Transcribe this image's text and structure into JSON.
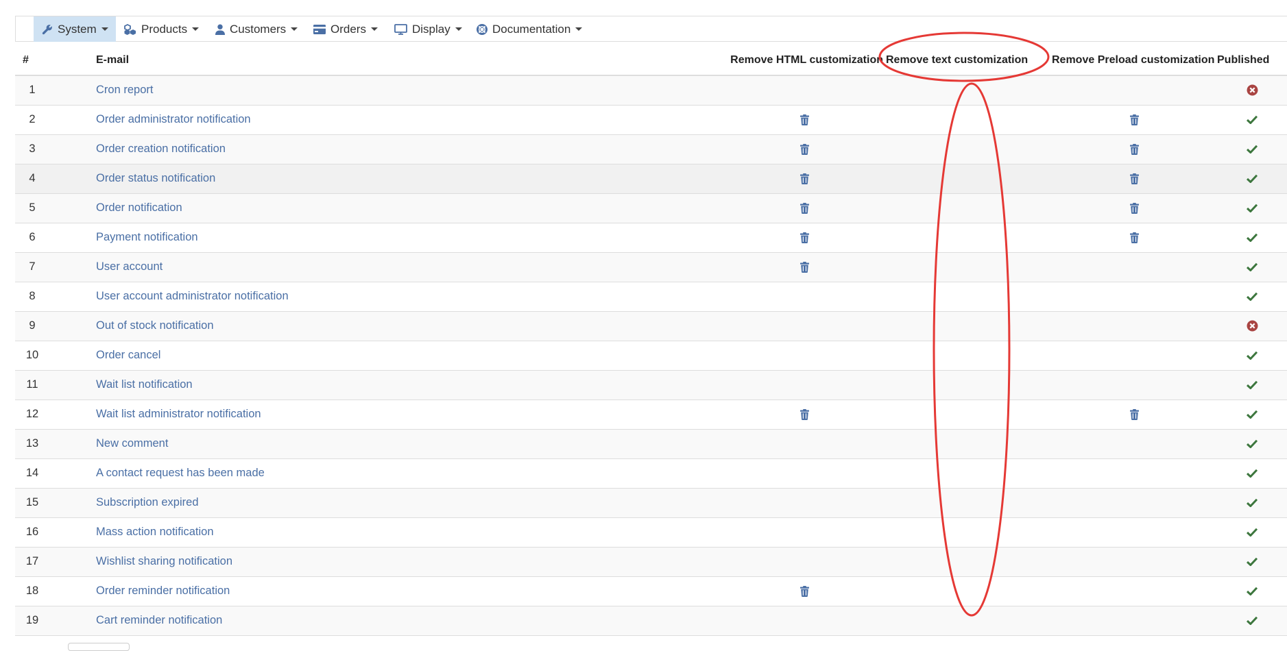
{
  "menu": {
    "items": [
      {
        "label": "System",
        "icon": "wrench-icon"
      },
      {
        "label": "Products",
        "icon": "cubes-icon"
      },
      {
        "label": "Customers",
        "icon": "user-icon"
      },
      {
        "label": "Orders",
        "icon": "credit-card-icon"
      },
      {
        "label": "Display",
        "icon": "monitor-icon"
      },
      {
        "label": "Documentation",
        "icon": "lifebuoy-icon"
      }
    ],
    "active": "System"
  },
  "table": {
    "columns": {
      "num": "#",
      "email": "E-mail",
      "remove_html": "Remove HTML customization",
      "remove_text": "Remove text customization",
      "remove_preload": "Remove Preload customization",
      "published": "Published"
    },
    "rows": [
      {
        "num": "1",
        "name": "Cron report",
        "html": false,
        "text": false,
        "preload": false,
        "published": false
      },
      {
        "num": "2",
        "name": "Order administrator notification",
        "html": true,
        "text": false,
        "preload": true,
        "published": true
      },
      {
        "num": "3",
        "name": "Order creation notification",
        "html": true,
        "text": false,
        "preload": true,
        "published": true
      },
      {
        "num": "4",
        "name": "Order status notification",
        "html": true,
        "text": false,
        "preload": true,
        "published": true
      },
      {
        "num": "5",
        "name": "Order notification",
        "html": true,
        "text": false,
        "preload": true,
        "published": true
      },
      {
        "num": "6",
        "name": "Payment notification",
        "html": true,
        "text": false,
        "preload": true,
        "published": true
      },
      {
        "num": "7",
        "name": "User account",
        "html": true,
        "text": false,
        "preload": false,
        "published": true
      },
      {
        "num": "8",
        "name": "User account administrator notification",
        "html": false,
        "text": false,
        "preload": false,
        "published": true
      },
      {
        "num": "9",
        "name": "Out of stock notification",
        "html": false,
        "text": false,
        "preload": false,
        "published": false
      },
      {
        "num": "10",
        "name": "Order cancel",
        "html": false,
        "text": false,
        "preload": false,
        "published": true
      },
      {
        "num": "11",
        "name": "Wait list notification",
        "html": false,
        "text": false,
        "preload": false,
        "published": true
      },
      {
        "num": "12",
        "name": "Wait list administrator notification",
        "html": true,
        "text": false,
        "preload": true,
        "published": true
      },
      {
        "num": "13",
        "name": "New comment",
        "html": false,
        "text": false,
        "preload": false,
        "published": true
      },
      {
        "num": "14",
        "name": "A contact request has been made",
        "html": false,
        "text": false,
        "preload": false,
        "published": true
      },
      {
        "num": "15",
        "name": "Subscription expired",
        "html": false,
        "text": false,
        "preload": false,
        "published": true
      },
      {
        "num": "16",
        "name": "Mass action notification",
        "html": false,
        "text": false,
        "preload": false,
        "published": true
      },
      {
        "num": "17",
        "name": "Wishlist sharing notification",
        "html": false,
        "text": false,
        "preload": false,
        "published": true
      },
      {
        "num": "18",
        "name": "Order reminder notification",
        "html": true,
        "text": false,
        "preload": false,
        "published": true
      },
      {
        "num": "19",
        "name": "Cart reminder notification",
        "html": false,
        "text": false,
        "preload": false,
        "published": true
      }
    ]
  },
  "colors": {
    "link": "#4a6fa5",
    "trash": "#4a6fa5",
    "published_yes": "#3c763d",
    "published_no": "#a94442",
    "annotation": "#e53935",
    "menu_active_bg": "#cfe2f3"
  }
}
